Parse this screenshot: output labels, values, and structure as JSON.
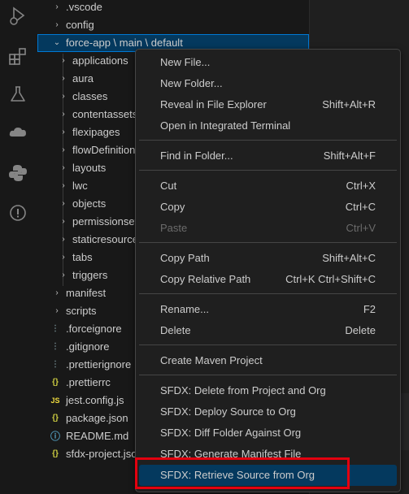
{
  "explorer": {
    "rows": [
      {
        "twisty": "›",
        "label": ".vscode"
      },
      {
        "twisty": "›",
        "label": "config"
      },
      {
        "twisty": "⌄",
        "label": "force-app \\ main \\ default"
      },
      {
        "twisty": "›",
        "label": "applications"
      },
      {
        "twisty": "›",
        "label": "aura"
      },
      {
        "twisty": "›",
        "label": "classes"
      },
      {
        "twisty": "›",
        "label": "contentassets"
      },
      {
        "twisty": "›",
        "label": "flexipages"
      },
      {
        "twisty": "›",
        "label": "flowDefinitions"
      },
      {
        "twisty": "›",
        "label": "layouts"
      },
      {
        "twisty": "›",
        "label": "lwc"
      },
      {
        "twisty": "›",
        "label": "objects"
      },
      {
        "twisty": "›",
        "label": "permissionsets"
      },
      {
        "twisty": "›",
        "label": "staticresources"
      },
      {
        "twisty": "›",
        "label": "tabs"
      },
      {
        "twisty": "›",
        "label": "triggers"
      },
      {
        "twisty": "›",
        "label": "manifest"
      },
      {
        "twisty": "›",
        "label": "scripts"
      },
      {
        "icon": "⋮",
        "label": ".forceignore"
      },
      {
        "icon": "⋮",
        "label": ".gitignore"
      },
      {
        "icon": "⋮",
        "label": ".prettierignore"
      },
      {
        "icon": "{}",
        "label": ".prettierrc"
      },
      {
        "icon": "JS",
        "label": "jest.config.js"
      },
      {
        "icon": "{}",
        "label": "package.json"
      },
      {
        "icon": "ⓘ",
        "label": "README.md"
      },
      {
        "icon": "{}",
        "label": "sfdx-project.json"
      }
    ]
  },
  "context_menu": {
    "items": [
      {
        "label": "New File...",
        "shortcut": ""
      },
      {
        "label": "New Folder...",
        "shortcut": ""
      },
      {
        "label": "Reveal in File Explorer",
        "shortcut": "Shift+Alt+R"
      },
      {
        "label": "Open in Integrated Terminal",
        "shortcut": ""
      },
      {
        "label": "Find in Folder...",
        "shortcut": "Shift+Alt+F"
      },
      {
        "label": "Cut",
        "shortcut": "Ctrl+X"
      },
      {
        "label": "Copy",
        "shortcut": "Ctrl+C"
      },
      {
        "label": "Paste",
        "shortcut": "Ctrl+V"
      },
      {
        "label": "Copy Path",
        "shortcut": "Shift+Alt+C"
      },
      {
        "label": "Copy Relative Path",
        "shortcut": "Ctrl+K Ctrl+Shift+C"
      },
      {
        "label": "Rename...",
        "shortcut": "F2"
      },
      {
        "label": "Delete",
        "shortcut": "Delete"
      },
      {
        "label": "Create Maven Project",
        "shortcut": ""
      },
      {
        "label": "SFDX: Delete from Project and Org",
        "shortcut": ""
      },
      {
        "label": "SFDX: Deploy Source to Org",
        "shortcut": ""
      },
      {
        "label": "SFDX: Diff Folder Against Org",
        "shortcut": ""
      },
      {
        "label": "SFDX: Generate Manifest File",
        "shortcut": ""
      },
      {
        "label": "SFDX: Retrieve Source from Org",
        "shortcut": ""
      }
    ]
  },
  "colors": {
    "accent": "#0078d4",
    "selection": "#04395e",
    "highlight_border": "#e3000f",
    "json_icon": "#cbcb41",
    "js_icon": "#f1dd3f",
    "info_icon": "#519aba"
  }
}
